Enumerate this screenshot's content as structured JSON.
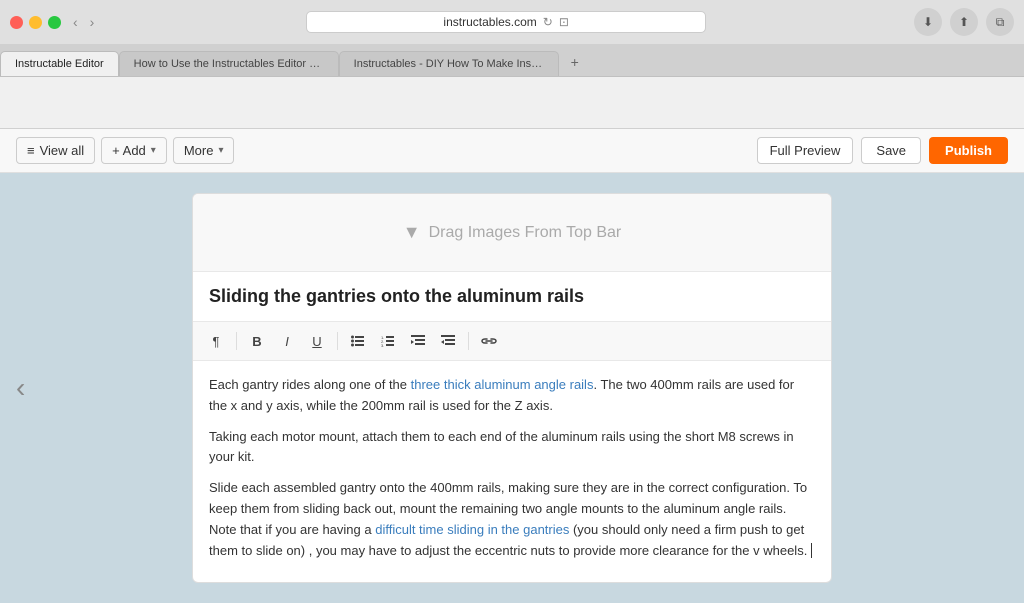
{
  "browser": {
    "url": "instructables.com",
    "tabs": [
      {
        "label": "Instructable Editor",
        "active": true
      },
      {
        "label": "How to Use the Instructables Editor - All",
        "active": false
      },
      {
        "label": "Instructables - DIY How To Make Instructions",
        "active": false
      }
    ],
    "tab_add": "+"
  },
  "toolbar": {
    "view_all_label": "View all",
    "add_label": "+ Add",
    "more_label": "More",
    "full_preview_label": "Full Preview",
    "save_label": "Save",
    "publish_label": "Publish"
  },
  "editor": {
    "drag_placeholder": "Drag Images From Top Bar",
    "title": "Sliding the gantries onto the aluminum rails",
    "paragraph1": "Each gantry rides along one of the three thick aluminum angle rails. The two 400mm rails are used for the x and y axis, while the 200mm rail is used for the Z axis.",
    "paragraph2": "Taking each motor mount, attach them to each end of the aluminum rails using the short M8 screws in your kit.",
    "paragraph3": "Slide each assembled gantry onto the 400mm rails, making sure they are in the correct configuration. To keep them from sliding back out, mount the remaining two angle mounts to the aluminum angle rails. Note that if you are having a difficult time sliding in the gantries (you should only need a firm push to get them to slide on) , you may have to adjust the eccentric nuts to provide more clearance for the v wheels."
  },
  "formatting": {
    "buttons": [
      "¶",
      "B",
      "I",
      "U",
      "≡",
      "≡",
      "≡",
      "≡",
      "⛓"
    ]
  }
}
